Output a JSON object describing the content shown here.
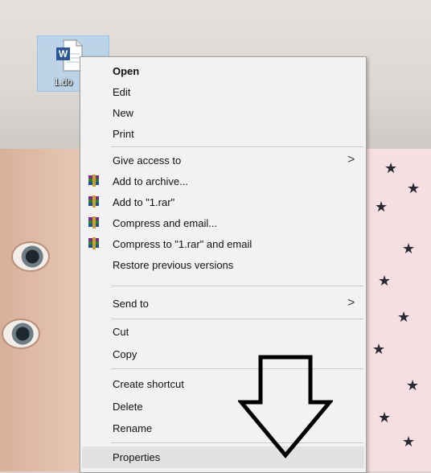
{
  "desktop": {
    "file_label": "1.do"
  },
  "context_menu": {
    "items": [
      {
        "label": "Open",
        "bold": true
      },
      {
        "label": "Edit"
      },
      {
        "label": "New"
      },
      {
        "label": "Print"
      },
      {
        "label": "Give access to",
        "submenu": true
      },
      {
        "label": "Add to archive...",
        "icon": "winrar-icon"
      },
      {
        "label": "Add to \"1.rar\"",
        "icon": "winrar-icon"
      },
      {
        "label": "Compress and email...",
        "icon": "winrar-icon"
      },
      {
        "label": "Compress to \"1.rar\" and email",
        "icon": "winrar-icon"
      },
      {
        "label": "Restore previous versions"
      },
      {
        "label": "Send to",
        "submenu": true
      },
      {
        "label": "Cut"
      },
      {
        "label": "Copy"
      },
      {
        "label": "Create shortcut"
      },
      {
        "label": "Delete"
      },
      {
        "label": "Rename"
      },
      {
        "label": "Properties",
        "highlighted": true
      }
    ],
    "submenu_arrow": ">"
  },
  "colors": {
    "menu_bg": "#f2f2f2",
    "hover_bg": "#e1e1e1",
    "selection_bg": "#b0d0ee"
  }
}
